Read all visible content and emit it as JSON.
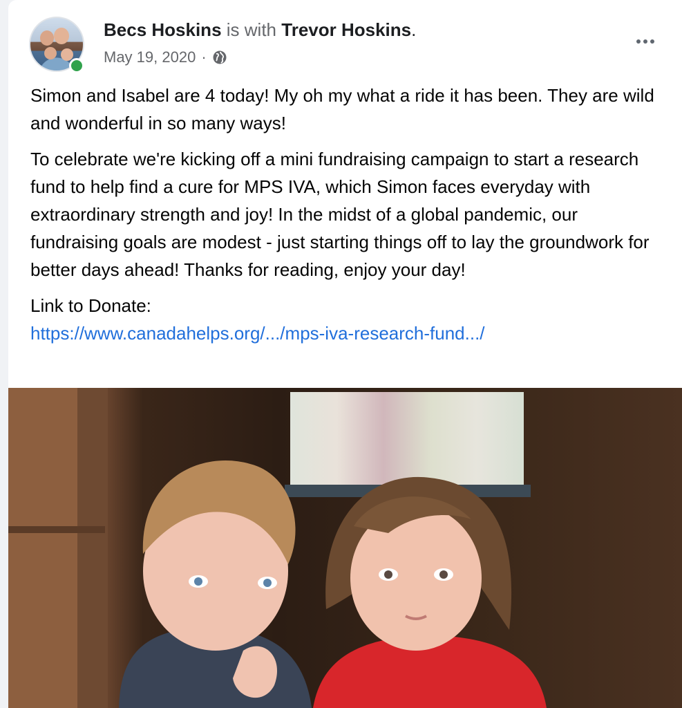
{
  "post": {
    "author": "Becs Hoskins",
    "with_text": "is with",
    "tagged": "Trevor Hoskins",
    "period": ".",
    "date": "May 19, 2020",
    "separator": "·",
    "audience_icon": "globe-icon",
    "more_icon": "more-options-icon",
    "paragraphs": [
      "Simon and Isabel are 4 today!  My oh my what a ride it has been. They are wild and wonderful in so many ways!",
      "To celebrate we're kicking off a mini fundraising campaign to start a research fund to help find a cure for MPS IVA, which Simon faces everyday with extraordinary strength and joy! In the midst of a global pandemic, our fundraising goals are modest - just starting things off to lay the groundwork for better days ahead! Thanks for reading, enjoy your day!"
    ],
    "link_label": "Link to Donate:",
    "link_url": "https://www.canadahelps.org/.../mps-iva-research-fund.../"
  },
  "colors": {
    "link": "#216fdb",
    "online": "#31a24c",
    "muted": "#65676b"
  }
}
